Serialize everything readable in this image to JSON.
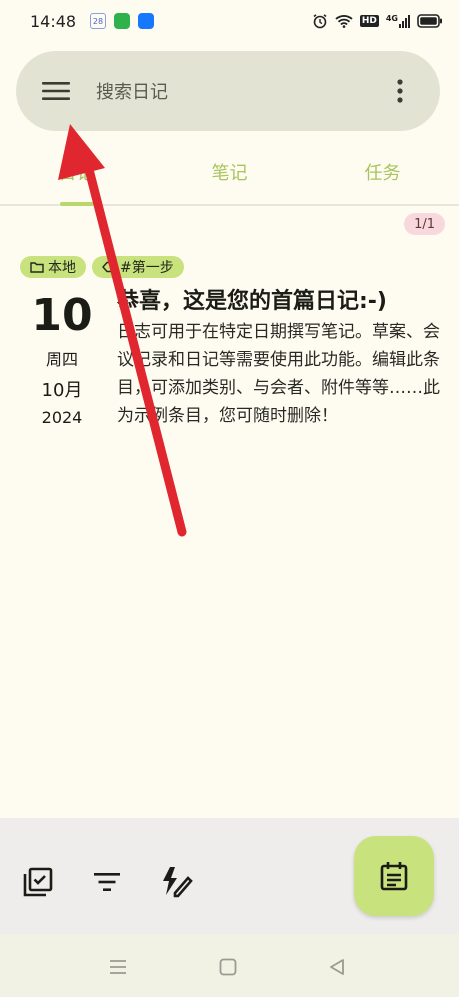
{
  "status_bar": {
    "time": "14:48",
    "calendar_app_date": "28",
    "network_label": "HD",
    "signal_label": "4G"
  },
  "search": {
    "placeholder": "搜索日记"
  },
  "tabs": [
    {
      "label": "日记",
      "active": true
    },
    {
      "label": "笔记",
      "active": false
    },
    {
      "label": "任务",
      "active": false
    }
  ],
  "page_indicator": "1/1",
  "entry": {
    "tags": [
      {
        "icon": "folder-icon",
        "label": "本地"
      },
      {
        "icon": "tag-icon",
        "label": "#第一步"
      }
    ],
    "day": "10",
    "weekday": "周四",
    "month": "10月",
    "year": "2024",
    "title": "恭喜，这是您的首篇日记:-)",
    "body": "日志可用于在特定日期撰写笔记。草案、会议记录和日记等需要使用此功能。编辑此条目，可添加类别、与会者、附件等等……此为示例条目，您可随时删除！"
  },
  "colors": {
    "accent": "#c8e27e",
    "tab_text": "#a8c45e",
    "background": "#fefcf1",
    "search_bg": "#e3e3d3",
    "annotation_arrow": "#e0262e"
  }
}
